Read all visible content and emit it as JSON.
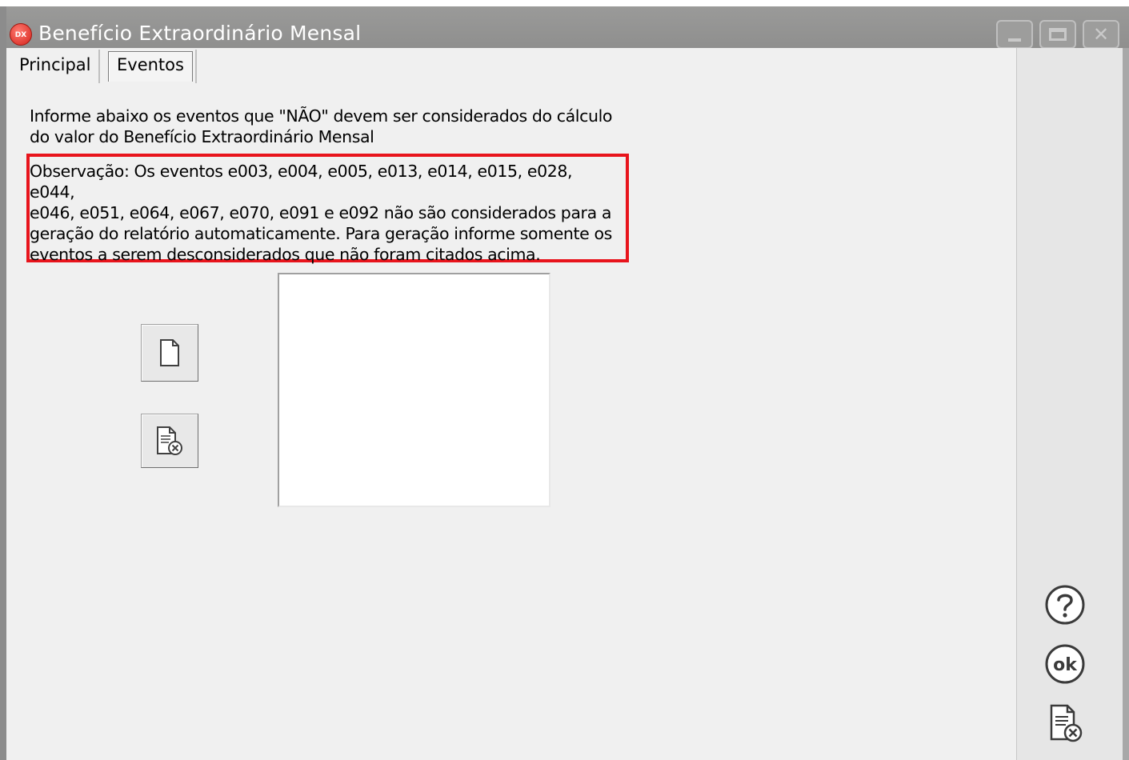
{
  "window": {
    "title": "Benefício Extraordinário Mensal",
    "app_icon_label": "DX",
    "icon": "app-logo-icon",
    "controls": {
      "minimize_icon": "minimize-icon",
      "maximize_icon": "maximize-icon",
      "close_icon": "close-icon"
    }
  },
  "tabs": [
    {
      "label": "Principal",
      "active": false
    },
    {
      "label": "Eventos",
      "active": true
    }
  ],
  "content": {
    "info_text_line1": "Informe abaixo os eventos que \"NÃO\" devem ser considerados do cálculo",
    "info_text_line2": "do valor do Benefício Extraordinário Mensal",
    "observation_line1": "Observação: Os eventos e003, e004, e005, e013, e014, e015, e028, e044,",
    "observation_line2": "e046, e051, e064, e067, e070, e091 e e092 não são considerados para a",
    "observation_line3": "geração do relatório automaticamente. Para geração informe somente os",
    "observation_line4": "eventos a serem desconsiderados que não foram citados acima.",
    "highlight_color": "#e8141c"
  },
  "actions": {
    "new_icon": "new-document-icon",
    "delete_icon": "delete-document-icon"
  },
  "right_panel": {
    "help_icon": "help-icon",
    "ok_icon": "ok-icon",
    "ok_label": "ok",
    "cancel_icon": "cancel-document-icon"
  },
  "colors": {
    "titlebar": "#8f8f8e",
    "client_bg": "#f0f0f0",
    "panel_bg": "#e6e6e6"
  }
}
